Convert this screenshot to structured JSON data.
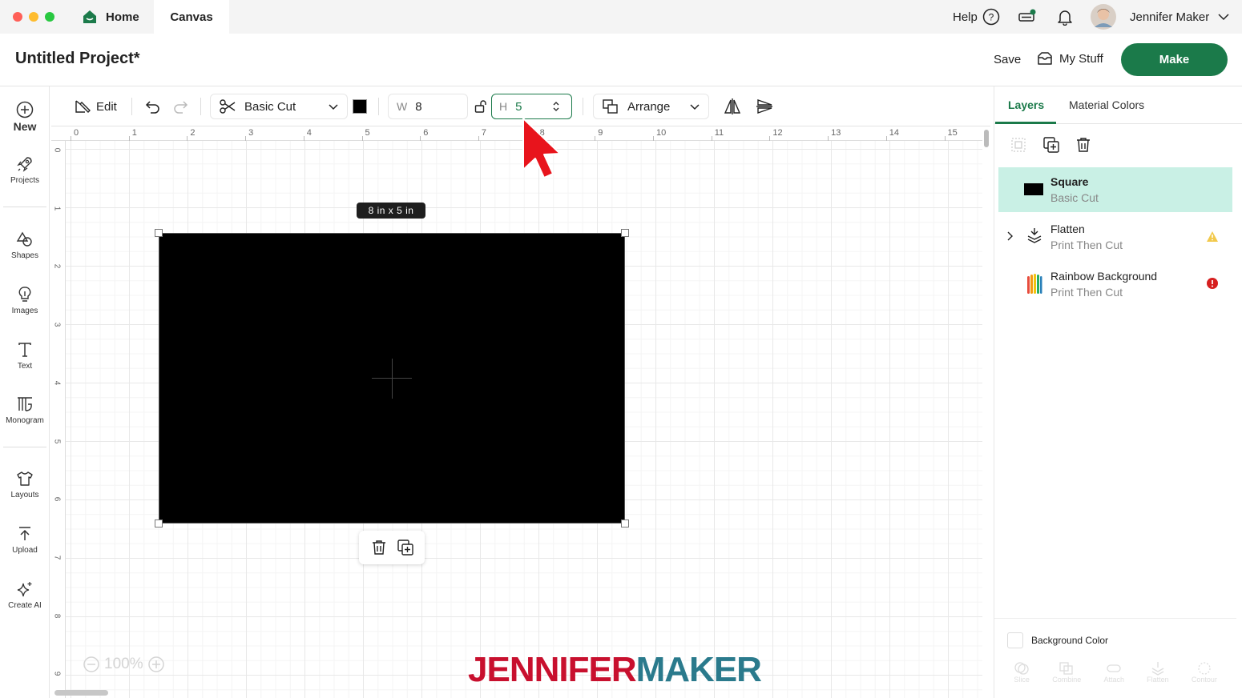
{
  "titlebar": {
    "tabs": [
      {
        "label": "Home"
      },
      {
        "label": "Canvas"
      }
    ],
    "help_label": "Help",
    "user_name": "Jennifer Maker"
  },
  "project": {
    "title": "Untitled Project*",
    "save_label": "Save",
    "mystuff_label": "My Stuff",
    "make_label": "Make"
  },
  "sidebar": {
    "items": [
      {
        "label": "New",
        "icon": "plus-circle-icon"
      },
      {
        "label": "Projects",
        "icon": "rocket-icon"
      },
      {
        "label": "Shapes",
        "icon": "shapes-icon"
      },
      {
        "label": "Images",
        "icon": "lightbulb-icon"
      },
      {
        "label": "Text",
        "icon": "text-icon"
      },
      {
        "label": "Monogram",
        "icon": "monogram-icon"
      },
      {
        "label": "Layouts",
        "icon": "shirt-icon"
      },
      {
        "label": "Upload",
        "icon": "upload-icon"
      },
      {
        "label": "Create AI",
        "icon": "sparkle-icon"
      }
    ]
  },
  "toolbar": {
    "edit_label": "Edit",
    "operation_label": "Basic Cut",
    "color_swatch": "#000000",
    "width_label": "W",
    "width_value": "8",
    "height_label": "H",
    "height_value": "5",
    "arrange_label": "Arrange"
  },
  "canvas": {
    "ruler_top": [
      "0",
      "1",
      "2",
      "3",
      "4",
      "5",
      "6",
      "7",
      "8",
      "9",
      "10",
      "11",
      "12",
      "13",
      "14",
      "15"
    ],
    "ruler_left": [
      "0",
      "1",
      "2",
      "3",
      "4",
      "5",
      "6",
      "7",
      "8",
      "9"
    ],
    "dimension_badge": "8 in x 5 in",
    "zoom_value": "100%",
    "shape_color": "#000000",
    "watermark": {
      "part1": "JENNIFER",
      "part2": "MAKER",
      "color1": "#c8102e",
      "color2": "#2a7a8c"
    }
  },
  "panel": {
    "tabs": [
      {
        "label": "Layers"
      },
      {
        "label": "Material Colors"
      }
    ],
    "layers": [
      {
        "name": "Square",
        "operation": "Basic Cut",
        "selected": true
      },
      {
        "name": "Flatten",
        "operation": "Print Then Cut",
        "warning": "yellow"
      },
      {
        "name": "Rainbow Background",
        "operation": "Print Then Cut",
        "warning": "red"
      }
    ],
    "background_color_label": "Background Color",
    "bottom_tools": [
      "Slice",
      "Combine",
      "Attach",
      "Flatten",
      "Contour"
    ]
  },
  "colors": {
    "brand_green": "#1b7a4a",
    "selected_layer": "#c9f0e5",
    "warning_yellow": "#f2c94c",
    "error_red": "#d61f1f",
    "cursor_red": "#e8141c"
  }
}
